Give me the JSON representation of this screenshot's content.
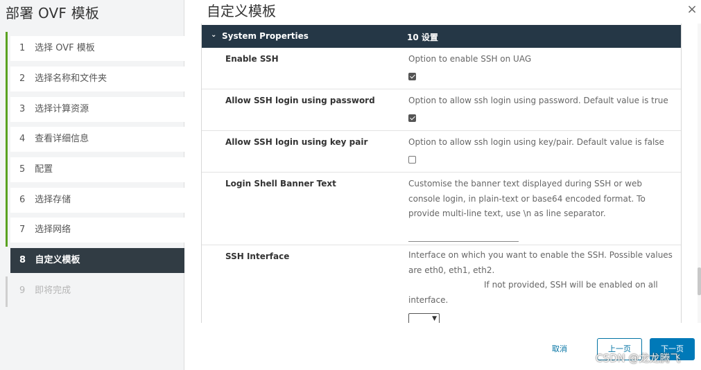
{
  "wizard": {
    "title": "部署 OVF 模板",
    "steps": [
      {
        "num": "1",
        "label": "选择 OVF 模板"
      },
      {
        "num": "2",
        "label": "选择名称和文件夹"
      },
      {
        "num": "3",
        "label": "选择计算资源"
      },
      {
        "num": "4",
        "label": "查看详细信息"
      },
      {
        "num": "5",
        "label": "配置"
      },
      {
        "num": "6",
        "label": "选择存储"
      },
      {
        "num": "7",
        "label": "选择网络"
      },
      {
        "num": "8",
        "label": "自定义模板"
      },
      {
        "num": "9",
        "label": "即将完成"
      }
    ],
    "active_step": "8"
  },
  "page": {
    "title": "自定义模板",
    "close_icon": "×"
  },
  "section": {
    "name": "System Properties",
    "count": "10 设置",
    "expanded": true
  },
  "properties": [
    {
      "name": "Enable SSH",
      "description": "Option to enable SSH on UAG",
      "control": "checkbox",
      "checked": true
    },
    {
      "name": "Allow SSH login using password",
      "description": "Option to allow ssh login using password. Default value is true",
      "control": "checkbox",
      "checked": true
    },
    {
      "name": "Allow SSH login using key pair",
      "description": "Option to allow ssh login using key/pair. Default value is false",
      "control": "checkbox",
      "checked": false
    },
    {
      "name": "Login Shell Banner Text",
      "description": "Customise the banner text displayed during SSH or web console login, in plain-text or base64 encoded format. To provide multi-line text, use \\n as line separator.",
      "control": "text",
      "value": ""
    },
    {
      "name": "SSH Interface",
      "description_1": "Interface on which you want to enable the SSH. Possible values are eth0, eth1, eth2.",
      "description_2": "If not provided, SSH will be enabled on all",
      "description_3": "interface.",
      "control": "select",
      "value": ""
    }
  ],
  "footer": {
    "cancel": "取消",
    "back": "上一页",
    "next": "下一页"
  },
  "watermark": "CSDN @龙龙腾飞",
  "colors": {
    "accent": "#0079b8",
    "active_step_bg": "#313c44",
    "section_header_bg": "#253746",
    "step_rail": "#5aa220"
  }
}
